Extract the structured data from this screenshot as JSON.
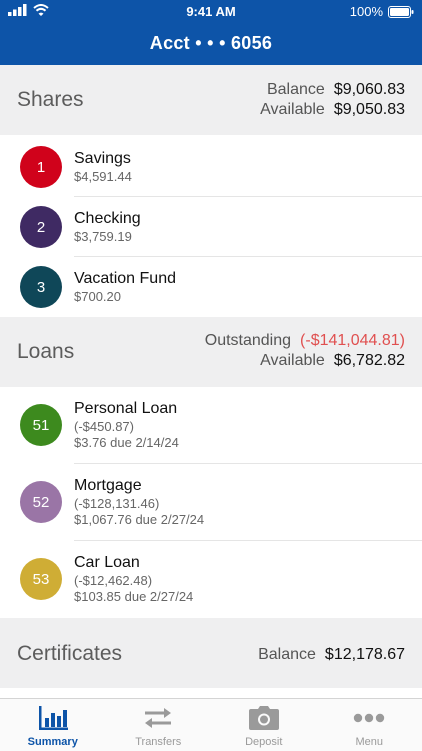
{
  "status_bar": {
    "time": "9:41 AM",
    "battery": "100%"
  },
  "header": {
    "title": "Acct • • • 6056"
  },
  "shares": {
    "title": "Shares",
    "balance_label": "Balance",
    "balance": "$9,060.83",
    "available_label": "Available",
    "available": "$9,050.83",
    "items": [
      {
        "num": "1",
        "name": "Savings",
        "amount": "$4,591.44",
        "color": "#d0021b"
      },
      {
        "num": "2",
        "name": "Checking",
        "amount": "$3,759.19",
        "color": "#3f2a63"
      },
      {
        "num": "3",
        "name": "Vacation Fund",
        "amount": "$700.20",
        "color": "#0f4758"
      }
    ]
  },
  "loans": {
    "title": "Loans",
    "outstanding_label": "Outstanding",
    "outstanding": "(-$141,044.81)",
    "available_label": "Available",
    "available": "$6,782.82",
    "items": [
      {
        "num": "51",
        "name": "Personal Loan",
        "amount": "(-$450.87)",
        "due": "$3.76 due 2/14/24",
        "color": "#3d8a1e"
      },
      {
        "num": "52",
        "name": "Mortgage",
        "amount": "(-$128,131.46)",
        "due": "$1,067.76 due 2/27/24",
        "color": "#9a75a6"
      },
      {
        "num": "53",
        "name": "Car Loan",
        "amount": "(-$12,462.48)",
        "due": "$103.85 due 2/27/24",
        "color": "#cfad35"
      }
    ]
  },
  "certificates": {
    "title": "Certificates",
    "balance_label": "Balance",
    "balance": "$12,178.67"
  },
  "tabs": [
    {
      "label": "Summary",
      "icon": "bar-chart-icon",
      "active": true
    },
    {
      "label": "Transfers",
      "icon": "transfer-arrows-icon",
      "active": false
    },
    {
      "label": "Deposit",
      "icon": "camera-icon",
      "active": false
    },
    {
      "label": "Menu",
      "icon": "more-dots-icon",
      "active": false
    }
  ],
  "colors": {
    "brand": "#0d54a8",
    "negative": "#e05050",
    "section_bg": "#efeff0"
  }
}
